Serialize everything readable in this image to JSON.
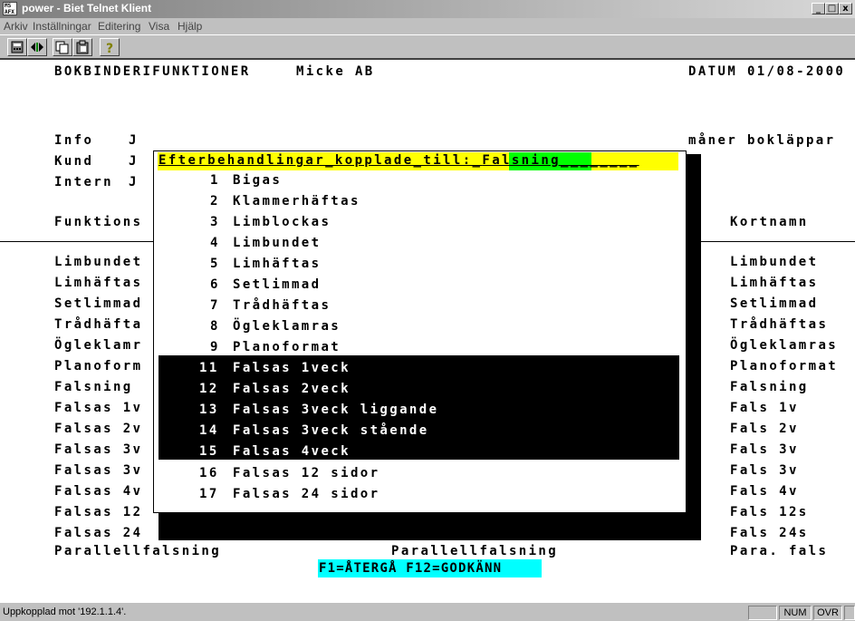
{
  "window": {
    "icon_text": "MS AFX",
    "title": "power - Biet Telnet Klient",
    "min_glyph": "_",
    "max_glyph": "□",
    "close_glyph": "x"
  },
  "menu": {
    "items": [
      "Arkiv",
      "Inställningar",
      "Editering",
      "Visa",
      "Hjälp"
    ]
  },
  "toolbar": {
    "buttons": [
      "calculator-icon",
      "connect-arrows-icon",
      "copy-icon",
      "paste-icon",
      "help-icon"
    ]
  },
  "terminal": {
    "header_left": "BOKBINDERIFUNKTIONER",
    "company": "Micke AB",
    "date": "DATUM 01/08-2000",
    "info_label": "Info",
    "info_value": "J",
    "kund_label": "Kund",
    "kund_value": "J",
    "intern_label": "Intern",
    "intern_value": "J",
    "right_note": "måner bokläppar",
    "funktions_label": "Funktions",
    "kortnamn_label": "Kortnamn",
    "left_rows": [
      "Limbundet",
      "Limhäftas",
      "Setlimmad",
      "Trådhäfta",
      "Ögleklamr",
      "Planoform",
      "Falsning",
      "Falsas 1v",
      "Falsas 2v",
      "Falsas 3v",
      "Falsas 3v",
      "Falsas 4v",
      "Falsas 12",
      "Falsas 24"
    ],
    "right_rows": [
      "Limbundet",
      "Limhäftas",
      "Setlimmad",
      "Trådhäftas",
      "Ögleklamras",
      "Planoformat",
      "Falsning",
      "Fals 1v",
      "Fals 2v",
      "Fals 3v",
      "Fals 3v",
      "Fals 4v",
      "Fals 12s",
      "Fals 24s"
    ],
    "last_row_left": "Parallellfalsning",
    "last_row_mid": "Parallellfalsning",
    "last_row_right": "Para. fals",
    "fkeys": "F1=ÅTERGÅ F12=GODKÄNN"
  },
  "popup": {
    "title_prefix": "Efterbehandlingar_kopplade_till:_",
    "title_value": "Falsning",
    "title_fill": "________",
    "items": [
      {
        "num": "1",
        "label": "Bigas",
        "selected": false
      },
      {
        "num": "2",
        "label": "Klammerhäftas",
        "selected": false
      },
      {
        "num": "3",
        "label": "Limblockas",
        "selected": false
      },
      {
        "num": "4",
        "label": "Limbundet",
        "selected": false
      },
      {
        "num": "5",
        "label": "Limhäftas",
        "selected": false
      },
      {
        "num": "6",
        "label": "Setlimmad",
        "selected": false
      },
      {
        "num": "7",
        "label": "Trådhäftas",
        "selected": false
      },
      {
        "num": "8",
        "label": "Ögleklamras",
        "selected": false
      },
      {
        "num": "9",
        "label": "Planoformat",
        "selected": false
      },
      {
        "num": "11",
        "label": "Falsas 1veck",
        "selected": true
      },
      {
        "num": "12",
        "label": "Falsas 2veck",
        "selected": true
      },
      {
        "num": "13",
        "label": "Falsas 3veck liggande",
        "selected": true
      },
      {
        "num": "14",
        "label": "Falsas 3veck stående",
        "selected": true
      },
      {
        "num": "15",
        "label": "Falsas 4veck",
        "selected": true
      },
      {
        "num": "16",
        "label": "Falsas 12 sidor",
        "selected": false
      },
      {
        "num": "17",
        "label": "Falsas 24 sidor",
        "selected": false
      }
    ]
  },
  "statusbar": {
    "text": "Uppkopplad mot '192.1.1.4'.",
    "num": "NUM",
    "ovr": "OVR"
  },
  "colors": {
    "header_yellow": "#ffff00",
    "header_green": "#00ff00",
    "fkey_cyan": "#00ffff",
    "selection": "#000000"
  }
}
